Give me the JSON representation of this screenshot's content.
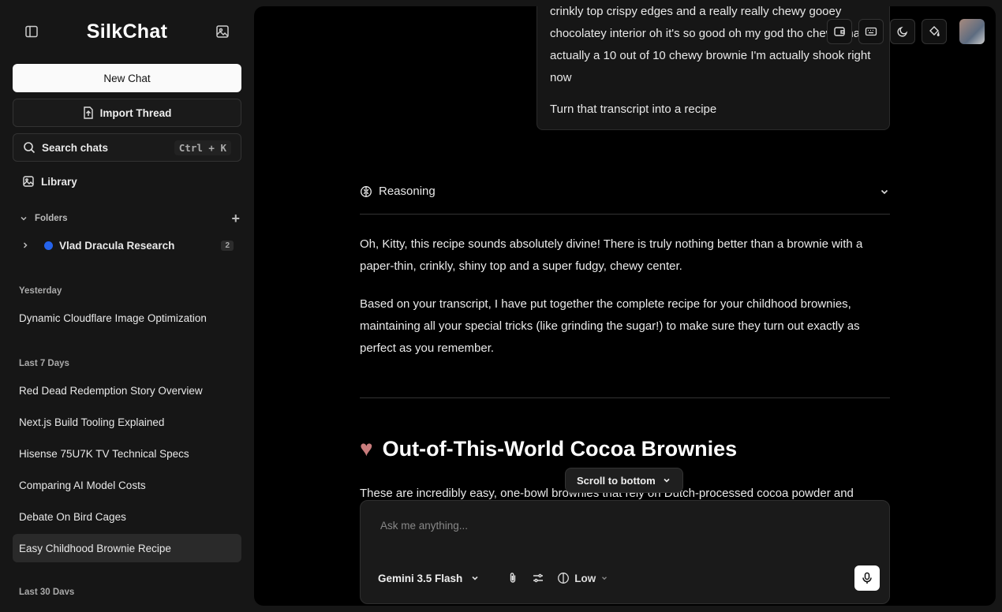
{
  "brand": "SilkChat",
  "sidebar": {
    "new_chat": "New Chat",
    "import_thread": "Import Thread",
    "search_label": "Search chats",
    "search_shortcut": "Ctrl + K",
    "library": "Library",
    "folders_label": "Folders",
    "folder": {
      "name": "Vlad Dracula Research",
      "count": "2",
      "color": "#2563eb"
    },
    "groups": [
      {
        "label": "Yesterday",
        "items": [
          "Dynamic Cloudflare Image Optimization"
        ]
      },
      {
        "label": "Last 7 Days",
        "items": [
          "Red Dead Redemption Story Overview",
          "Next.js Build Tooling Explained",
          "Hisense 75U7K TV Technical Specs",
          "Comparing AI Model Costs",
          "Debate On Bird Cages",
          "Easy Childhood Brownie Recipe"
        ]
      },
      {
        "label": "Last 30 Days",
        "items": []
      }
    ],
    "active_item": "Easy Childhood Brownie Recipe"
  },
  "conversation": {
    "user_message_part1": "crinkly top crispy edges and a really really chewy gooey chocolatey interior oh it's so good oh my god tho chewy that is actually a 10 out of 10 chewy brownie I'm actually shook right now",
    "user_message_part2": "Turn that transcript into a recipe",
    "reasoning_label": "Reasoning",
    "answer_p1": "Oh, Kitty, this recipe sounds absolutely divine! There is truly nothing better than a brownie with a paper-thin, crinkly, shiny top and a super fudgy, chewy center.",
    "answer_p2": "Based on your transcript, I have put together the complete recipe for your childhood brownies, maintaining all your special tricks (like grinding the sugar!) to make sure they turn out exactly as perfect as you remember.",
    "heading": "Out-of-This-World Cocoa Brownies",
    "answer_p3_partial": "These are incredibly easy, one-bowl brownies that rely on Dutch-processed cocoa powder and"
  },
  "scroll_to_bottom": "Scroll to bottom",
  "composer": {
    "placeholder": "Ask me anything...",
    "model": "Gemini 3.5 Flash",
    "effort": "Low"
  },
  "colors": {
    "accent": "#ffffff",
    "panel": "#000000",
    "sidebar": "#161616",
    "folder_dot": "#2563eb"
  }
}
